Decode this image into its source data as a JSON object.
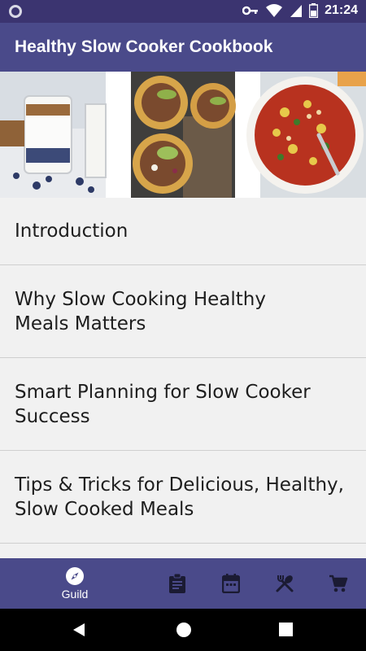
{
  "status_bar": {
    "time": "21:24",
    "icons": [
      "circle-indicator-icon",
      "key-icon",
      "wifi-icon",
      "signal-icon",
      "battery-icon"
    ]
  },
  "app_bar": {
    "title": "Healthy Slow Cooker Cookbook"
  },
  "hero_images": [
    "yogurt-parfait-image",
    "pulled-pork-tostadas-image",
    "vegetable-stew-image"
  ],
  "chapters": [
    {
      "label": "Introduction"
    },
    {
      "label": "Why Slow Cooking Healthy\nMeals Matters"
    },
    {
      "label": "Smart Planning for Slow Cooker\nSuccess"
    },
    {
      "label": "Tips & Tricks for Delicious, Healthy,\nSlow Cooked Meals"
    }
  ],
  "bottom_nav": {
    "items": [
      {
        "icon": "compass-icon",
        "label": "Guild",
        "active": true
      },
      {
        "icon": "clipboard-icon",
        "label": ""
      },
      {
        "icon": "calendar-icon",
        "label": ""
      },
      {
        "icon": "utensils-icon",
        "label": ""
      },
      {
        "icon": "cart-icon",
        "label": ""
      }
    ]
  },
  "colors": {
    "status_bar": "#3b3470",
    "primary": "#4a4a8a",
    "list_bg": "#f1f1f1",
    "divider": "#cfcfcf"
  }
}
